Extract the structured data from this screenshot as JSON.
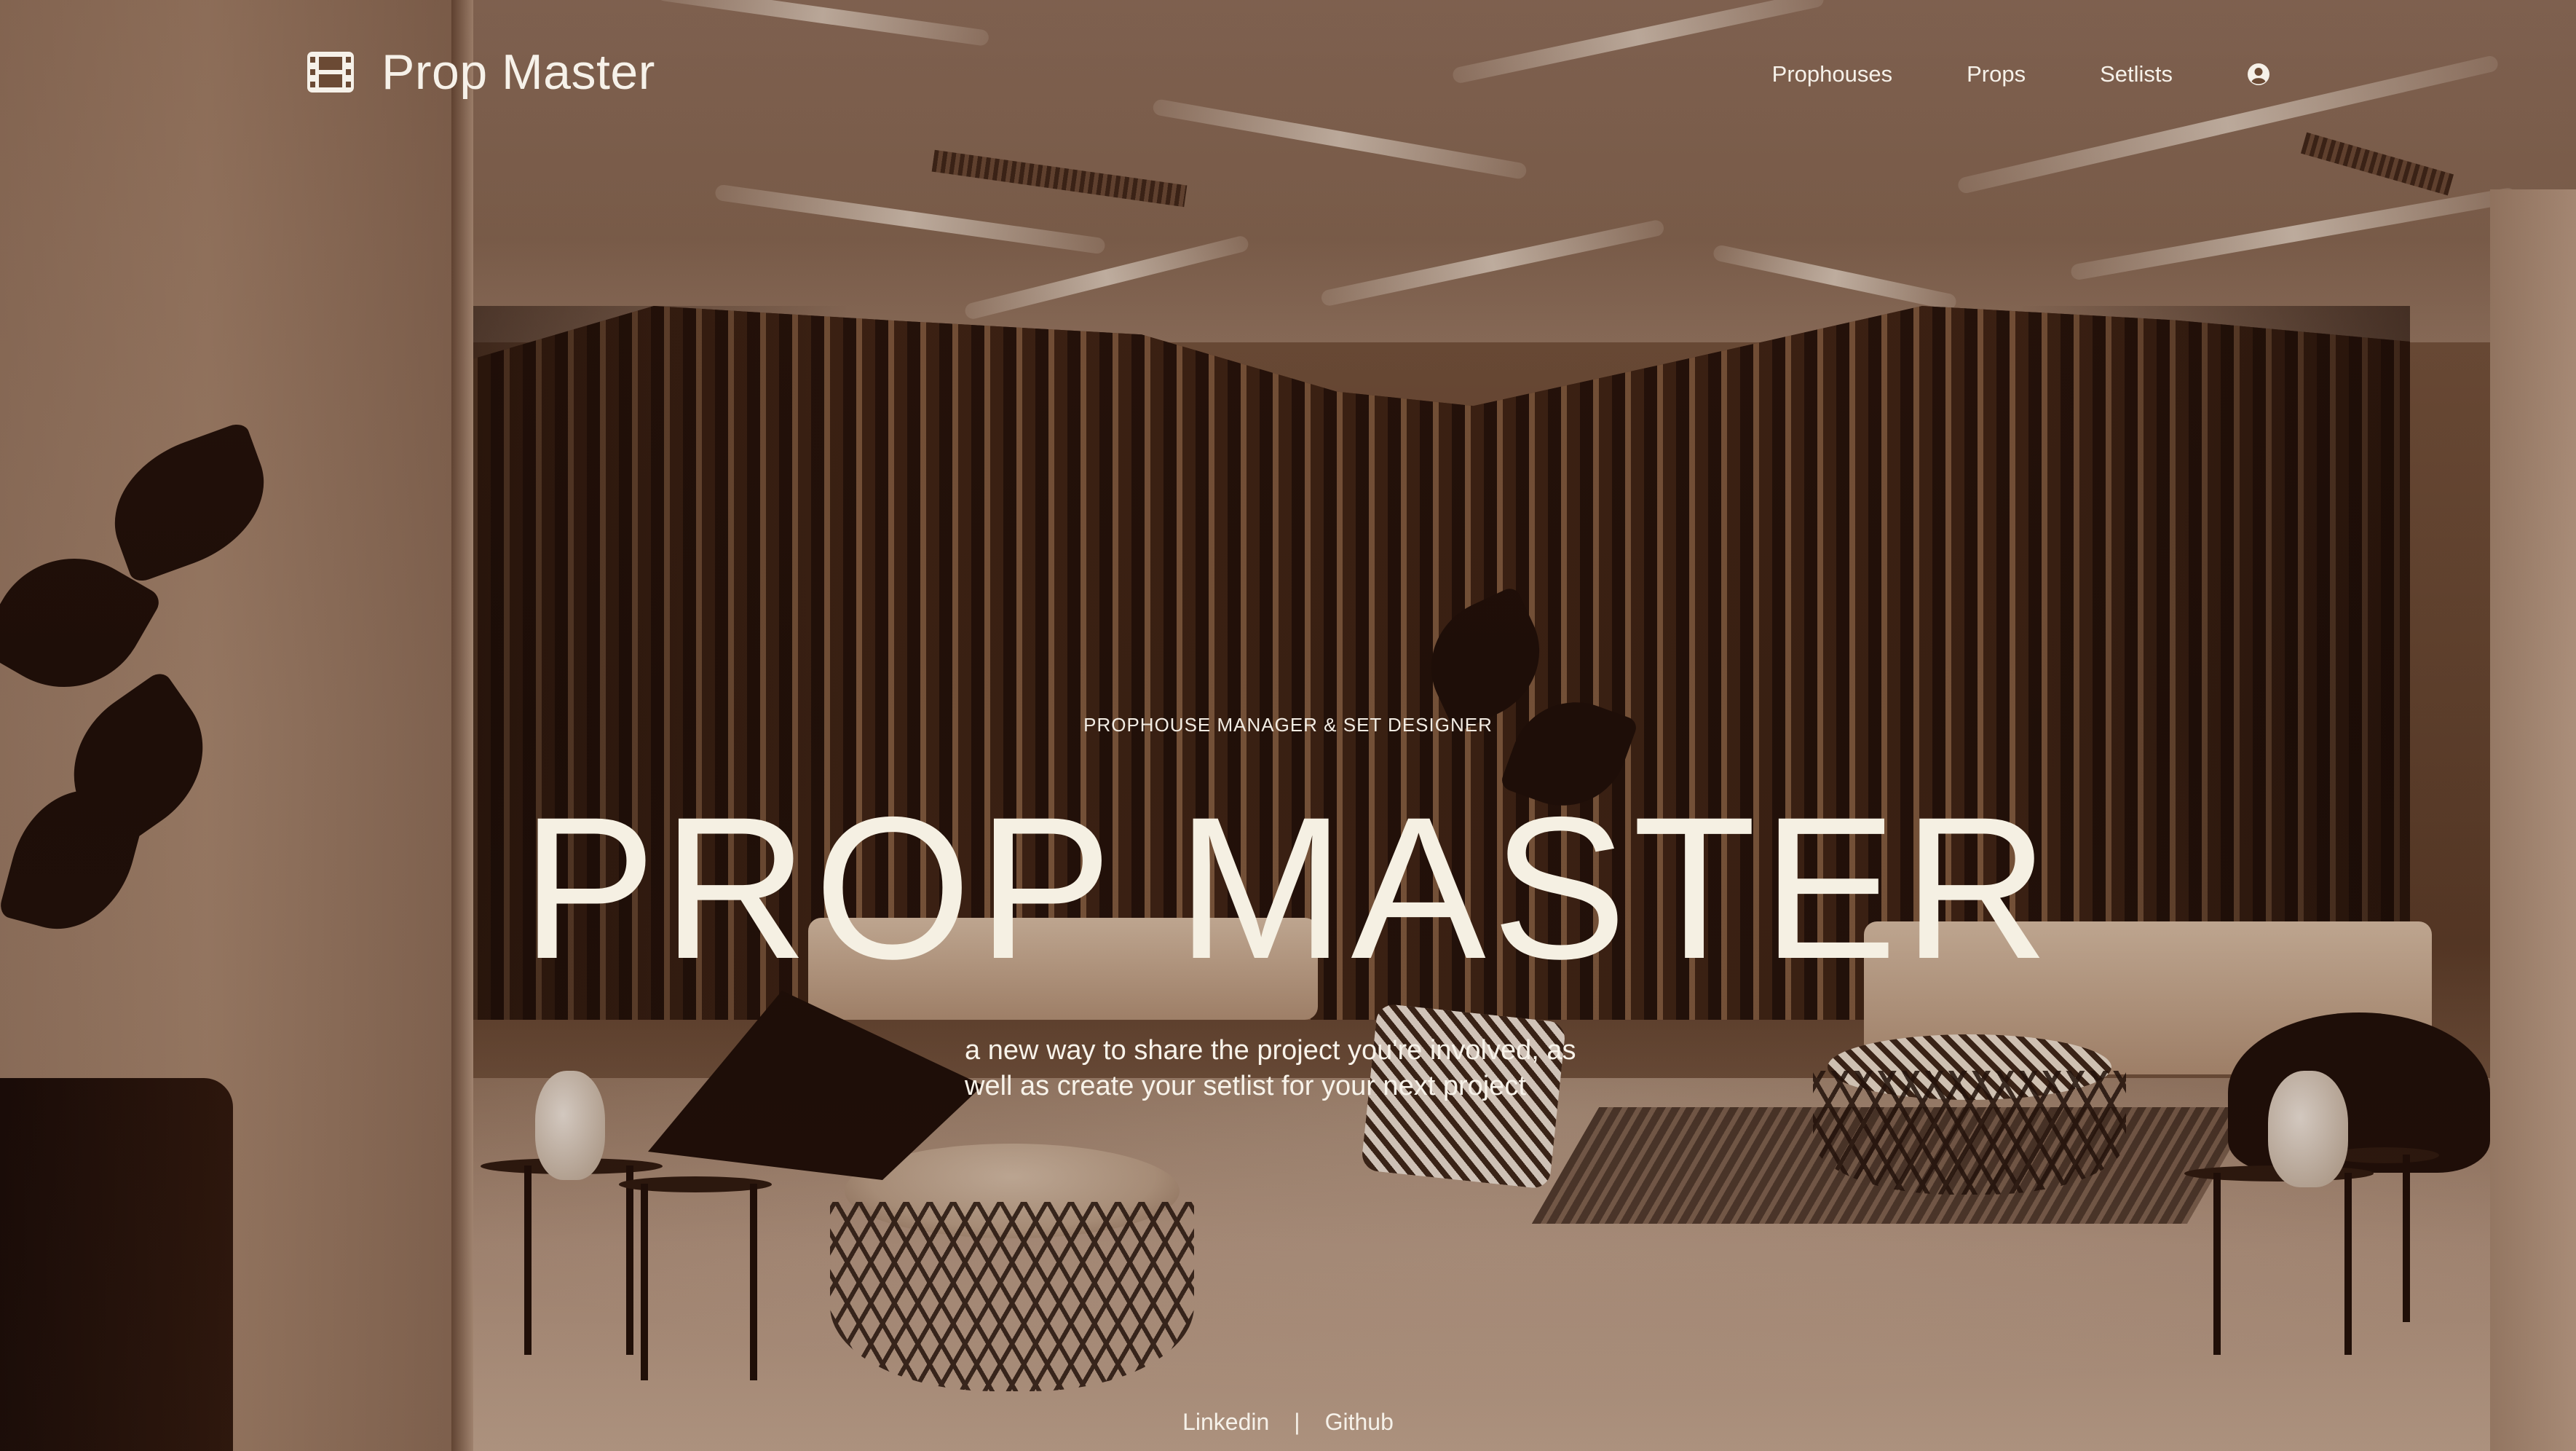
{
  "header": {
    "brand_icon": "film-icon",
    "brand_name": "Prop Master",
    "nav": [
      {
        "label": "Prophouses"
      },
      {
        "label": "Props"
      },
      {
        "label": "Setlists"
      }
    ],
    "account_icon": "user-circle-icon"
  },
  "hero": {
    "eyebrow": "PROPHOUSE MANAGER & SET DESIGNER",
    "title": "PROP MASTER",
    "tagline": "a new way to share the project you're involved, as well as create your setlist for your next project"
  },
  "footer": {
    "links": [
      {
        "label": "Linkedin"
      },
      {
        "label": "Github"
      }
    ],
    "separator": "|"
  },
  "colors": {
    "text": "#f6f1e9",
    "sepia_background": "#6b4a34"
  }
}
